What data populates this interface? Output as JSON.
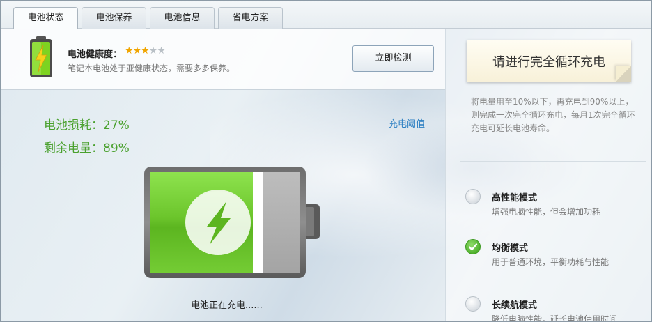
{
  "tabs": [
    {
      "label": "电池状态",
      "active": true
    },
    {
      "label": "电池保养",
      "active": false
    },
    {
      "label": "电池信息",
      "active": false
    },
    {
      "label": "省电方案",
      "active": false
    }
  ],
  "health": {
    "label": "电池健康度：",
    "stars_filled": 3,
    "stars_total": 5,
    "description": "笔记本电池处于亚健康状态，需要多多保养。",
    "check_button": "立即检测"
  },
  "stats": {
    "loss": "电池损耗：27%",
    "remaining": "剩余电量：89%",
    "remaining_level": 0.89,
    "threshold_link": "充电阈值"
  },
  "charging_status": "电池正在充电......",
  "right": {
    "note_title": "请进行完全循环充电",
    "cycle_description": "将电量用至10%以下，再充电到90%以上，则完成一次完全循环充电，每月1次完全循环充电可延长电池寿命。",
    "modes": [
      {
        "title": "高性能模式",
        "desc": "增强电脑性能，但会增加功耗",
        "selected": false
      },
      {
        "title": "均衡模式",
        "desc": "用于普通环境，平衡功耗与性能",
        "selected": true
      },
      {
        "title": "长续航模式",
        "desc": "降低电脑性能，延长电池使用时间",
        "selected": false
      }
    ]
  },
  "colors": {
    "accent_green": "#4aa12e",
    "link_blue": "#2a7ec2",
    "star_gold": "#f0a500"
  }
}
